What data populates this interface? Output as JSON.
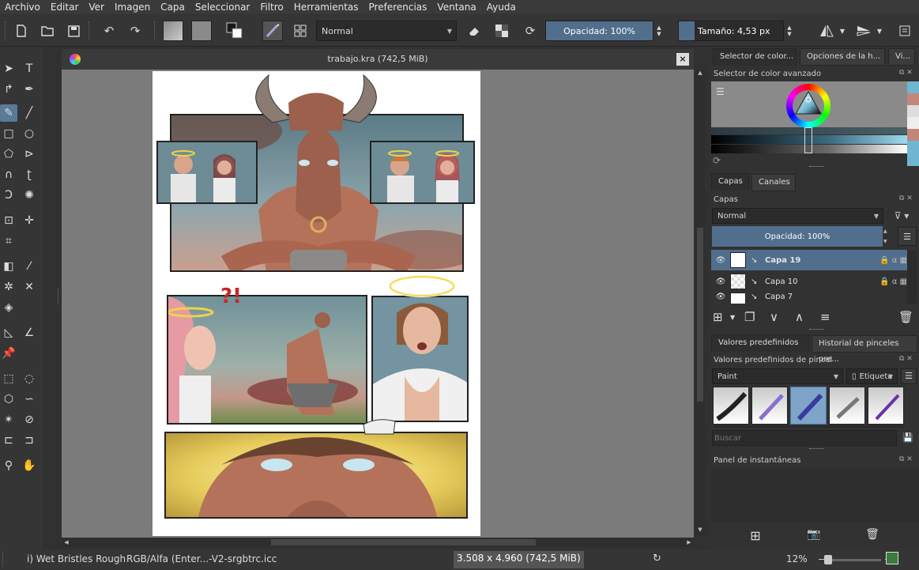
{
  "menu": [
    "Archivo",
    "Editar",
    "Ver",
    "Imagen",
    "Capa",
    "Seleccionar",
    "Filtro",
    "Herramientas",
    "Preferencias",
    "Ventana",
    "Ayuda"
  ],
  "toolbar": {
    "blend_mode": "Normal",
    "opacity_label": "Opacidad: 100%",
    "size_label": "Tamaño: 4,53 px"
  },
  "document": {
    "tab_title": "trabajo.kra (742,5 MiB)",
    "close_glyph": "×"
  },
  "comic": {
    "exclaim_text": "?!"
  },
  "dock": {
    "tabs_top": [
      "Selector de color...",
      "Opciones de la h...",
      "Vi..."
    ],
    "color_selector_title": "Selector de color avanzado",
    "layers_tabs": [
      "Capas",
      "Canales"
    ],
    "layers_title": "Capas",
    "layer_blend": "Normal",
    "layer_opacity": "Opacidad:  100%",
    "layers": [
      {
        "name": "Capa 19",
        "selected": true
      },
      {
        "name": "Capa 10",
        "selected": false
      },
      {
        "name": "Capa 7",
        "selected": false
      }
    ],
    "presets_tabs": [
      "Valores predefinidos ...",
      "Historial de pinceles pre..."
    ],
    "presets_title": "Valores predefinidos de pincel",
    "presets_combo": "Paint",
    "presets_tag": "Etiqueta",
    "search_placeholder": "Buscar",
    "snapshot_title": "Panel de instantáneas"
  },
  "status": {
    "brush": "i) Wet Bristles Rough",
    "color_profile": "RGB/Alfa (Enter...-V2-srgbtrc.icc",
    "dimensions": "3.508 x 4.960 (742,5 MiB)",
    "zoom": "12%"
  },
  "colors": {
    "accent": "#516e8c",
    "canvas_bg": "#7b7b7b",
    "panel_bg": "#323232"
  }
}
